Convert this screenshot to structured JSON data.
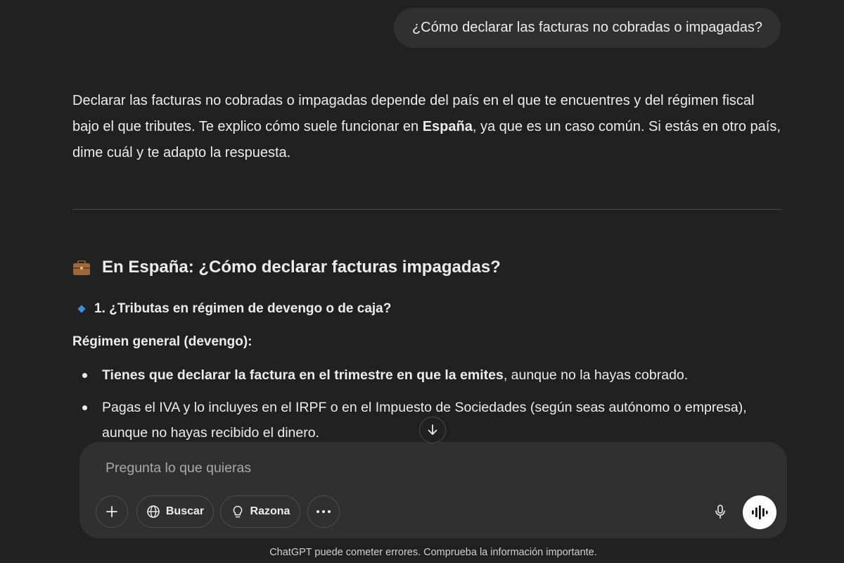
{
  "user_message": "¿Cómo declarar las facturas no cobradas o impagadas?",
  "answer": {
    "intro": {
      "part1": "Declarar las facturas no cobradas o impagadas depende del país en el que te encuentres y del régimen fiscal bajo el que tributes. Te explico cómo suele funcionar en ",
      "bold": "España",
      "part2": ", ya que es un caso común. Si estás en otro país, dime cuál y te adapto la respuesta."
    },
    "heading_icon": "briefcase-icon",
    "heading": "En España: ¿Cómo declarar facturas impagadas?",
    "subheading_icon": "blue-diamond-icon",
    "subheading": "1. ¿Tributas en régimen de devengo o de caja?",
    "regimen_label": "Régimen general (devengo):",
    "bullets": [
      {
        "bold": "Tienes que declarar la factura en el trimestre en que la emites",
        "text": ", aunque no la hayas cobrado."
      },
      {
        "bold": "",
        "text": "Pagas el IVA y lo incluyes en el IRPF o en el Impuesto de Sociedades (según seas autónomo o empresa), aunque no hayas recibido el dinero."
      }
    ]
  },
  "composer": {
    "placeholder": "Pregunta lo que quieras",
    "buttons": {
      "add_icon": "plus-icon",
      "search_label": "Buscar",
      "search_icon": "globe-icon",
      "reason_label": "Razona",
      "reason_icon": "lightbulb-icon",
      "more_icon": "ellipsis-icon",
      "mic_icon": "microphone-icon",
      "voice_icon": "voice-waveform-icon"
    }
  },
  "scroll_icon": "arrow-down-icon",
  "disclaimer": "ChatGPT puede cometer errores. Comprueba la información importante.",
  "colors": {
    "background": "#212121",
    "bubble": "#303030",
    "composer": "#303030",
    "text": "#ececec",
    "diamond": "#3b8fd9"
  }
}
